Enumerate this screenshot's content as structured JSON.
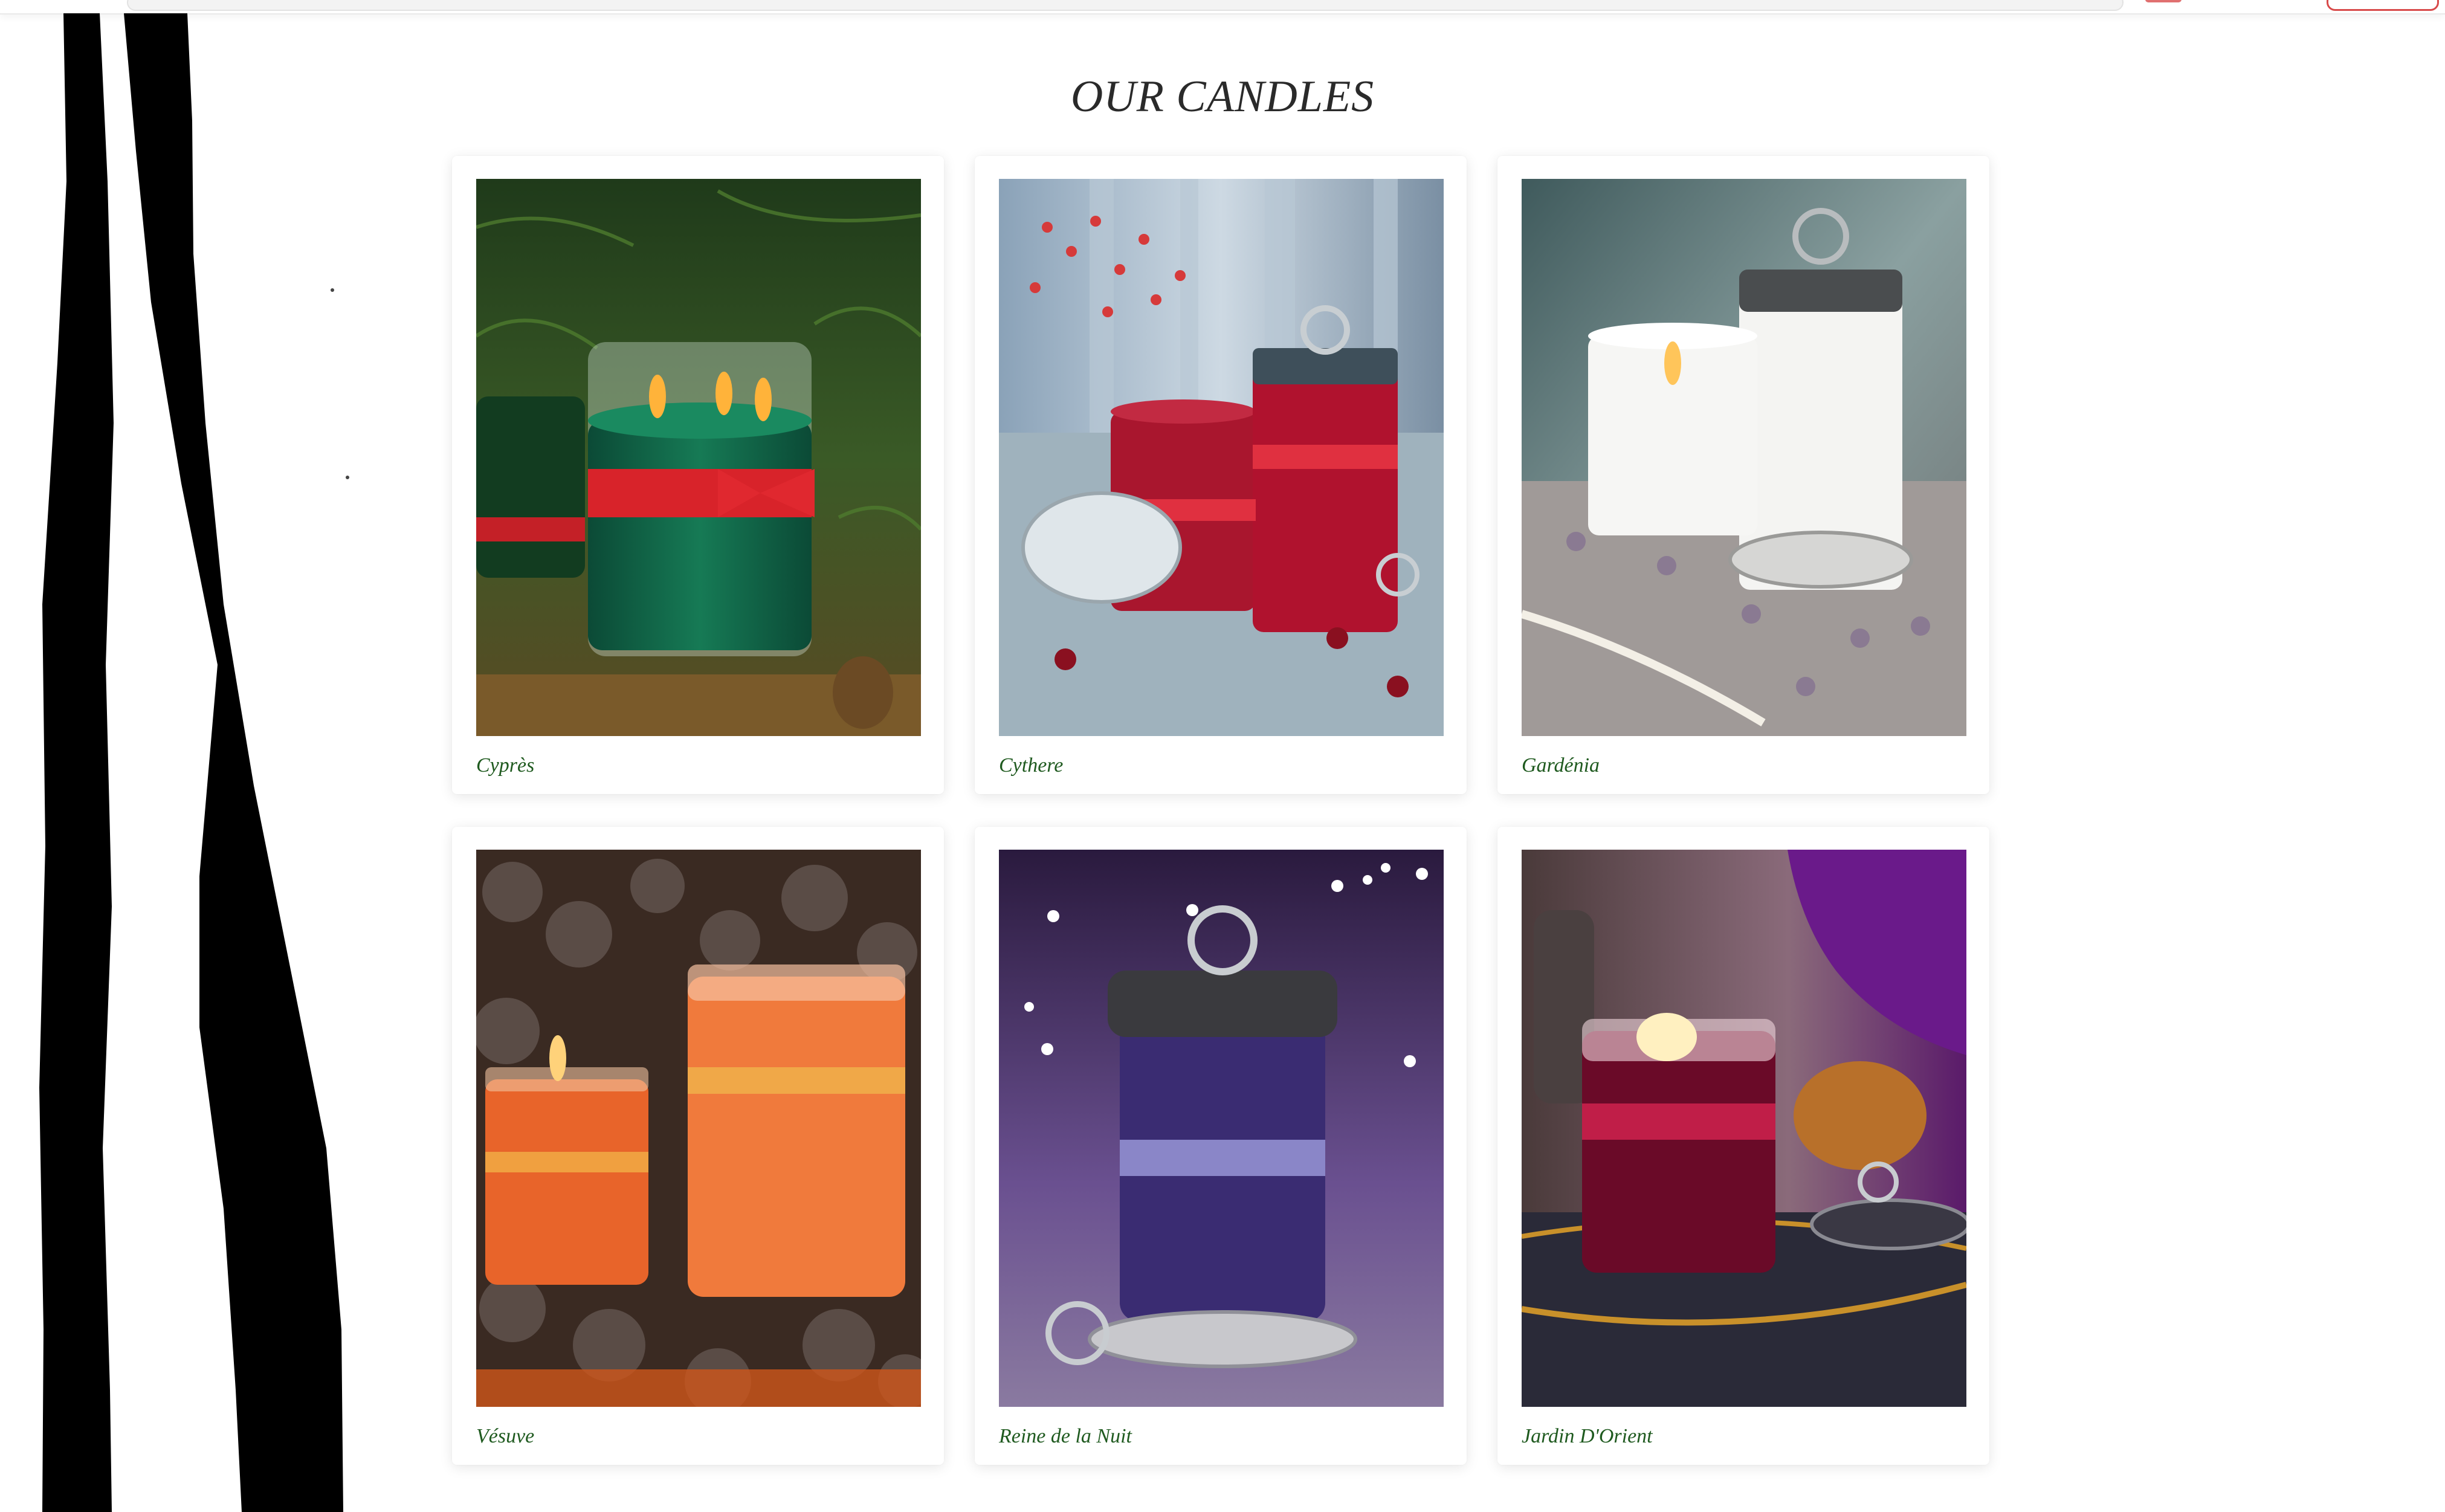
{
  "page": {
    "title": "OUR CANDLES"
  },
  "colors": {
    "caption": "#1f5a1f",
    "title": "#2a2a2a",
    "background": "#ffffff"
  },
  "candles": [
    {
      "name": "Cyprès"
    },
    {
      "name": "Cythere"
    },
    {
      "name": "Gardénia"
    },
    {
      "name": "Vésuve"
    },
    {
      "name": "Reine de la Nuit"
    },
    {
      "name": "Jardin D'Orient"
    }
  ]
}
